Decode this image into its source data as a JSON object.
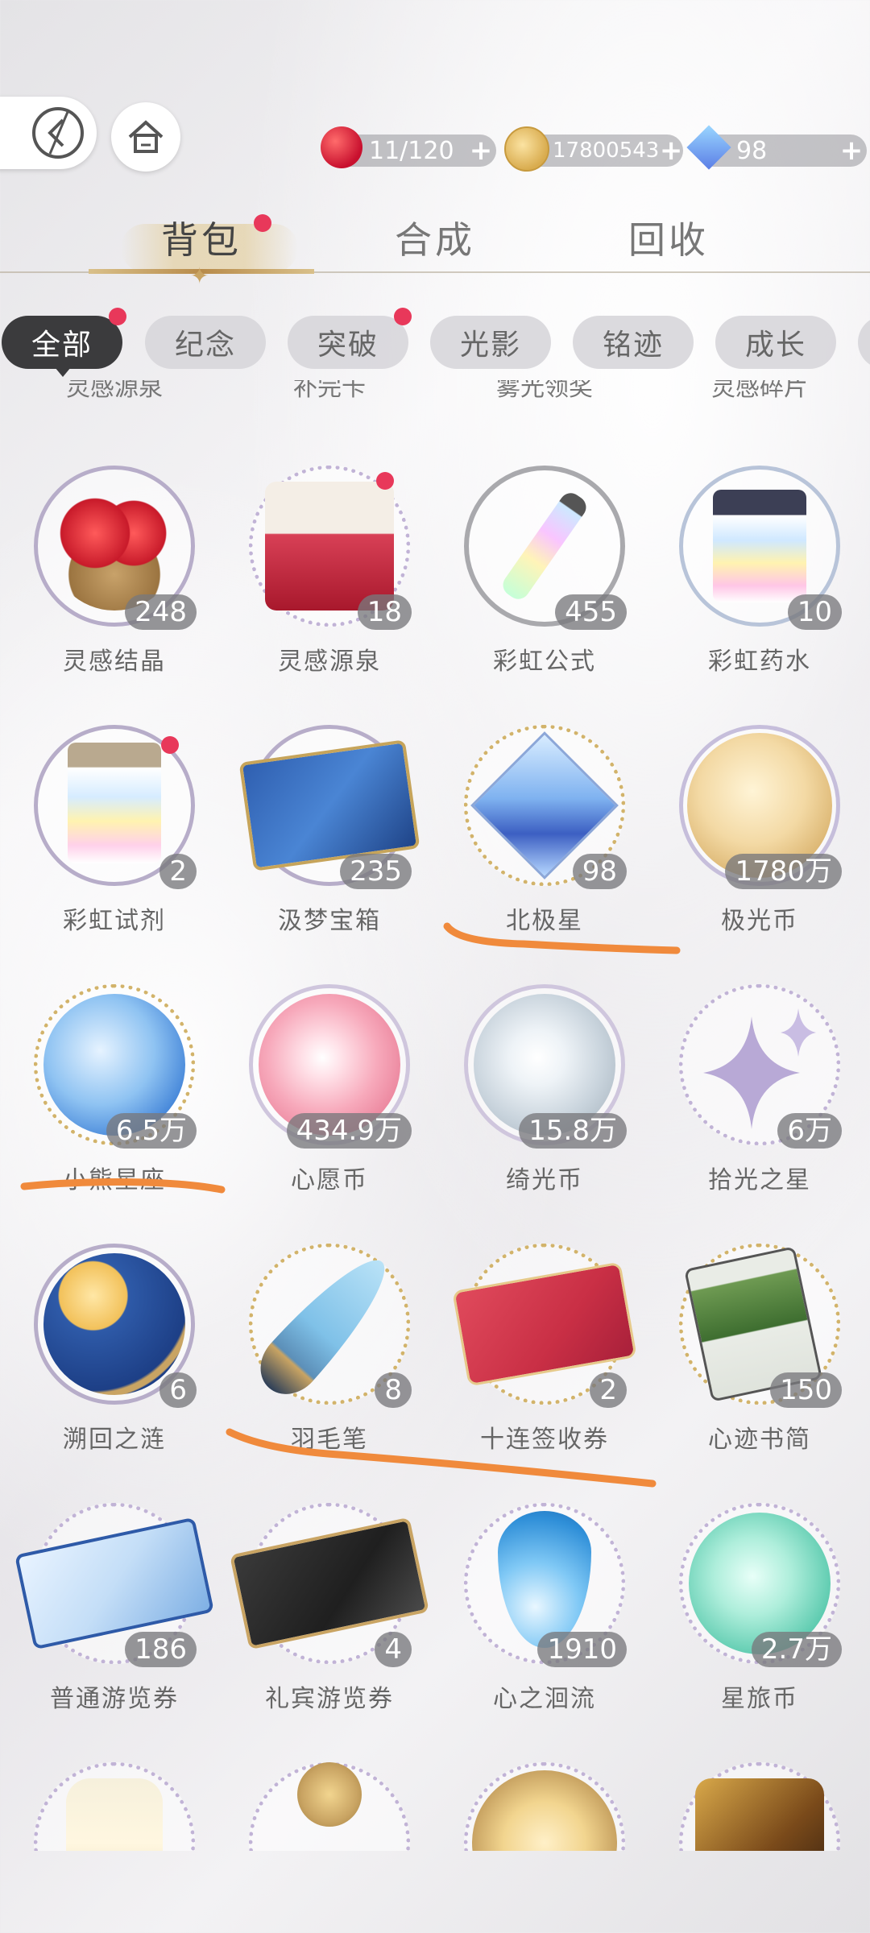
{
  "top_bar": {
    "back_icon": "back-arrow-icon",
    "home_icon": "home-icon",
    "resources": [
      {
        "icon": "apple-icon",
        "value": "11/120",
        "plus": "+"
      },
      {
        "icon": "gold-coin-icon",
        "value": "17800543",
        "plus": "+"
      },
      {
        "icon": "diamond-icon",
        "value": "98",
        "plus": "+"
      }
    ]
  },
  "main_tabs": [
    {
      "label": "背包",
      "active": true,
      "badge": true
    },
    {
      "label": "合成",
      "active": false,
      "badge": false
    },
    {
      "label": "回收",
      "active": false,
      "badge": false
    }
  ],
  "filters": [
    {
      "label": "全部",
      "active": true,
      "badge": true
    },
    {
      "label": "纪念",
      "active": false,
      "badge": false
    },
    {
      "label": "突破",
      "active": false,
      "badge": true
    },
    {
      "label": "光影",
      "active": false,
      "badge": false
    },
    {
      "label": "铭迹",
      "active": false,
      "badge": false
    },
    {
      "label": "成长",
      "active": false,
      "badge": false
    }
  ],
  "partial_row": [
    "灵感源泉",
    "补完卡",
    "雾光领奖",
    "灵感碎片"
  ],
  "items": [
    {
      "name": "灵感结晶",
      "count": "248",
      "icon": "apple-basket-icon",
      "badge": false
    },
    {
      "name": "灵感源泉",
      "count": "18",
      "icon": "apple-box-icon",
      "badge": true
    },
    {
      "name": "彩虹公式",
      "count": "455",
      "icon": "rainbow-tube-icon",
      "badge": false
    },
    {
      "name": "彩虹药水",
      "count": "10",
      "icon": "rainbow-jar-icon",
      "badge": false
    },
    {
      "name": "彩虹试剂",
      "count": "2",
      "icon": "rainbow-bottle-icon",
      "badge": true
    },
    {
      "name": "汲梦宝箱",
      "count": "235",
      "icon": "blue-chest-icon",
      "badge": false
    },
    {
      "name": "北极星",
      "count": "98",
      "icon": "crystal-star-icon",
      "badge": false
    },
    {
      "name": "极光币",
      "count": "1780万",
      "icon": "gold-coin-icon",
      "badge": false
    },
    {
      "name": "小熊星座",
      "count": "6.5万",
      "icon": "bear-coin-icon",
      "badge": false
    },
    {
      "name": "心愿币",
      "count": "434.9万",
      "icon": "flower-coin-icon",
      "badge": false
    },
    {
      "name": "绮光币",
      "count": "15.8万",
      "icon": "silver-coin-icon",
      "badge": false
    },
    {
      "name": "拾光之星",
      "count": "6万",
      "icon": "sparkle-star-icon",
      "badge": false
    },
    {
      "name": "溯回之涟",
      "count": "6",
      "icon": "sun-moon-icon",
      "badge": false
    },
    {
      "name": "羽毛笔",
      "count": "8",
      "icon": "quill-pen-icon",
      "badge": false
    },
    {
      "name": "十连签收券",
      "count": "2",
      "icon": "red-card-icon",
      "badge": false
    },
    {
      "name": "心迹书简",
      "count": "150",
      "icon": "letter-card-icon",
      "badge": false
    },
    {
      "name": "普通游览券",
      "count": "186",
      "icon": "ticket-icon",
      "badge": false
    },
    {
      "name": "礼宾游览券",
      "count": "4",
      "icon": "vip-ticket-icon",
      "badge": false
    },
    {
      "name": "心之洄流",
      "count": "1910",
      "icon": "water-drop-icon",
      "badge": false
    },
    {
      "name": "星旅币",
      "count": "2.7万",
      "icon": "teal-coin-icon",
      "badge": false
    }
  ],
  "bottom_partial_icons": [
    "bottle-icon",
    "key-icon",
    "compass-icon",
    "bread-icon"
  ],
  "colors": {
    "badge": "#e8385a",
    "annotation": "#f08a3c",
    "gold": "#c9a463"
  }
}
